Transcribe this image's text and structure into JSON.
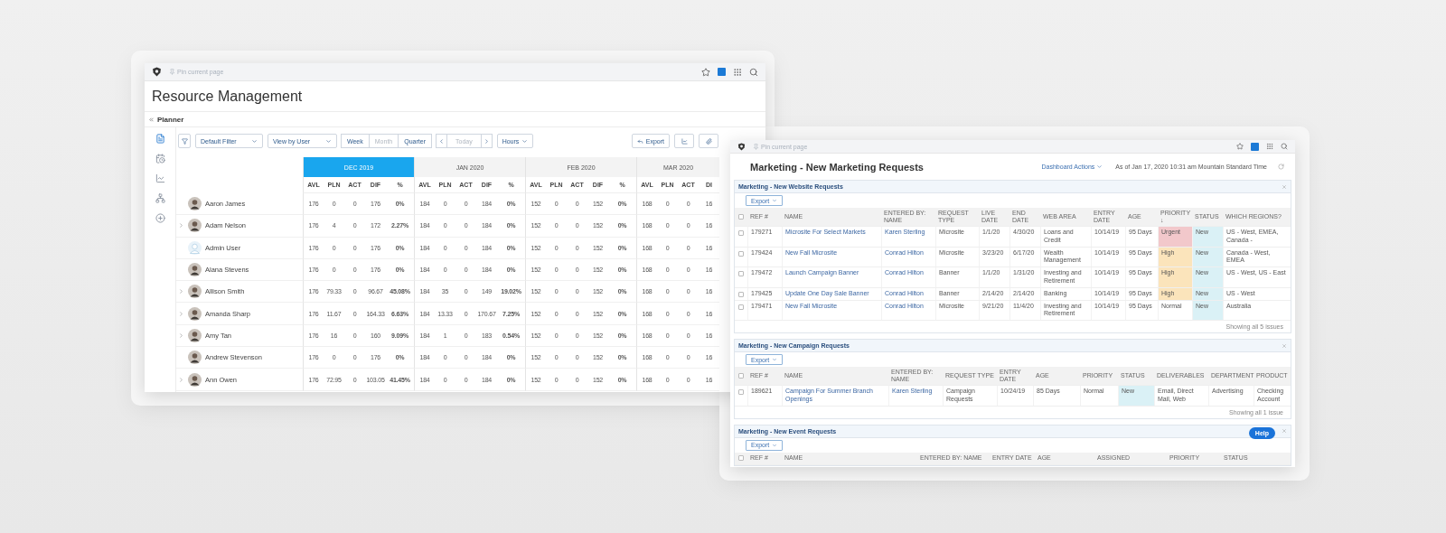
{
  "resource_window": {
    "pin_label": "Pin current page",
    "title": "Resource Management",
    "breadcrumb": "Planner",
    "toolbar": {
      "dropdowns": [
        "Default Filter",
        "View by User"
      ],
      "periods": [
        {
          "label": "Week",
          "disabled": false
        },
        {
          "label": "Month",
          "disabled": true
        },
        {
          "label": "Quarter",
          "disabled": false
        }
      ],
      "today": {
        "label": "Today",
        "disabled": true
      },
      "unit": "Hours",
      "export": "Export"
    },
    "months": [
      {
        "label": "DEC 2019",
        "selected": true,
        "columns": [
          "AVL",
          "PLN",
          "ACT",
          "DIF",
          "%"
        ]
      },
      {
        "label": "JAN 2020",
        "selected": false,
        "columns": [
          "AVL",
          "PLN",
          "ACT",
          "DIF",
          "%"
        ]
      },
      {
        "label": "FEB 2020",
        "selected": false,
        "columns": [
          "AVL",
          "PLN",
          "ACT",
          "DIF",
          "%"
        ]
      },
      {
        "label": "MAR 2020",
        "selected": false,
        "columns": [
          "AVL",
          "PLN",
          "ACT",
          "DI"
        ]
      }
    ],
    "rows": [
      {
        "name": "Aaron James",
        "kind": "photo",
        "expandable": false,
        "values": [
          [
            "176",
            "0",
            "0",
            "176",
            "0%"
          ],
          [
            "184",
            "0",
            "0",
            "184",
            "0%"
          ],
          [
            "152",
            "0",
            "0",
            "152",
            "0%"
          ],
          [
            "168",
            "0",
            "0",
            "16"
          ]
        ]
      },
      {
        "name": "Adam Nelson",
        "kind": "photo",
        "expandable": true,
        "values": [
          [
            "176",
            "4",
            "0",
            "172",
            "2.27%"
          ],
          [
            "184",
            "0",
            "0",
            "184",
            "0%"
          ],
          [
            "152",
            "0",
            "0",
            "152",
            "0%"
          ],
          [
            "168",
            "0",
            "0",
            "16"
          ]
        ]
      },
      {
        "name": "Admin User",
        "kind": "placeholder",
        "expandable": false,
        "values": [
          [
            "176",
            "0",
            "0",
            "176",
            "0%"
          ],
          [
            "184",
            "0",
            "0",
            "184",
            "0%"
          ],
          [
            "152",
            "0",
            "0",
            "152",
            "0%"
          ],
          [
            "168",
            "0",
            "0",
            "16"
          ]
        ]
      },
      {
        "name": "Alana Stevens",
        "kind": "photo",
        "expandable": false,
        "values": [
          [
            "176",
            "0",
            "0",
            "176",
            "0%"
          ],
          [
            "184",
            "0",
            "0",
            "184",
            "0%"
          ],
          [
            "152",
            "0",
            "0",
            "152",
            "0%"
          ],
          [
            "168",
            "0",
            "0",
            "16"
          ]
        ]
      },
      {
        "name": "Allison Smith",
        "kind": "photo",
        "expandable": true,
        "values": [
          [
            "176",
            "79.33",
            "0",
            "96.67",
            "45.08%"
          ],
          [
            "184",
            "35",
            "0",
            "149",
            "19.02%"
          ],
          [
            "152",
            "0",
            "0",
            "152",
            "0%"
          ],
          [
            "168",
            "0",
            "0",
            "16"
          ]
        ]
      },
      {
        "name": "Amanda Sharp",
        "kind": "photo",
        "expandable": true,
        "values": [
          [
            "176",
            "11.67",
            "0",
            "164.33",
            "6.63%"
          ],
          [
            "184",
            "13.33",
            "0",
            "170.67",
            "7.25%"
          ],
          [
            "152",
            "0",
            "0",
            "152",
            "0%"
          ],
          [
            "168",
            "0",
            "0",
            "16"
          ]
        ]
      },
      {
        "name": "Amy Tan",
        "kind": "photo",
        "expandable": true,
        "values": [
          [
            "176",
            "16",
            "0",
            "160",
            "9.09%"
          ],
          [
            "184",
            "1",
            "0",
            "183",
            "0.54%"
          ],
          [
            "152",
            "0",
            "0",
            "152",
            "0%"
          ],
          [
            "168",
            "0",
            "0",
            "16"
          ]
        ]
      },
      {
        "name": "Andrew Stevenson",
        "kind": "photo",
        "expandable": false,
        "values": [
          [
            "176",
            "0",
            "0",
            "176",
            "0%"
          ],
          [
            "184",
            "0",
            "0",
            "184",
            "0%"
          ],
          [
            "152",
            "0",
            "0",
            "152",
            "0%"
          ],
          [
            "168",
            "0",
            "0",
            "16"
          ]
        ]
      },
      {
        "name": "Ann Owen",
        "kind": "photo",
        "expandable": true,
        "values": [
          [
            "176",
            "72.95",
            "0",
            "103.05",
            "41.45%"
          ],
          [
            "184",
            "0",
            "0",
            "184",
            "0%"
          ],
          [
            "152",
            "0",
            "0",
            "152",
            "0%"
          ],
          [
            "168",
            "0",
            "0",
            "16"
          ]
        ]
      }
    ]
  },
  "marketing_window": {
    "pin_label": "Pin current page",
    "title": "Marketing - New Marketing Requests",
    "actions": "Dashboard Actions",
    "timestamp": "As of Jan 17, 2020 10:31 am Mountain Standard Time",
    "help": "Help",
    "sections": [
      {
        "title": "Marketing - New Website Requests",
        "export": "Export",
        "all_checked": false,
        "columns": [
          {
            "label": "REF #",
            "kind": "text"
          },
          {
            "label": "NAME",
            "kind": "link"
          },
          {
            "label": "ENTERED BY: NAME",
            "kind": "link"
          },
          {
            "label": "REQUEST TYPE",
            "kind": "text"
          },
          {
            "label": "LIVE DATE",
            "kind": "text"
          },
          {
            "label": "END DATE",
            "kind": "text"
          },
          {
            "label": "WEB AREA",
            "kind": "text"
          },
          {
            "label": "ENTRY DATE",
            "kind": "text"
          },
          {
            "label": "AGE",
            "kind": "text"
          },
          {
            "label": "PRIORITY ↓",
            "kind": "priority"
          },
          {
            "label": "STATUS",
            "kind": "status"
          },
          {
            "label": "WHICH REGIONS?",
            "kind": "text"
          }
        ],
        "rows": [
          {
            "checked": false,
            "color": "#f2c8cb",
            "cells": [
              "179271",
              "Microsite For Select Markets",
              "Karen Sterling",
              "Microsite",
              "1/1/20",
              "4/30/20",
              "Loans and Credit",
              "10/14/19",
              "95 Days",
              "Urgent",
              "New",
              "US - West, EMEA, Canada -"
            ]
          },
          {
            "checked": false,
            "color": "#fbe4bb",
            "cells": [
              "179424",
              "New Fall Microsite",
              "Conrad Hilton",
              "Microsite",
              "3/23/20",
              "6/17/20",
              "Wealth Management",
              "10/14/19",
              "95 Days",
              "High",
              "New",
              "Canada - West, EMEA"
            ]
          },
          {
            "checked": false,
            "color": "#fbe4bb",
            "cells": [
              "179472",
              "Launch Campaign Banner",
              "Conrad Hilton",
              "Banner",
              "1/1/20",
              "1/31/20",
              "Investing and Retirement",
              "10/14/19",
              "95 Days",
              "High",
              "New",
              "US - West, US - East"
            ]
          },
          {
            "checked": false,
            "color": "#fbe4bb",
            "cells": [
              "179425",
              "Update One Day Sale Banner",
              "Conrad Hilton",
              "Banner",
              "2/14/20",
              "2/14/20",
              "Banking",
              "10/14/19",
              "95 Days",
              "High",
              "New",
              "US - West"
            ]
          },
          {
            "checked": false,
            "cells": [
              "179471",
              "New Fall Microsite",
              "Conrad Hilton",
              "Microsite",
              "9/21/20",
              "11/4/20",
              "Investing and Retirement",
              "10/14/19",
              "95 Days",
              "Normal",
              "New",
              "Australia"
            ]
          }
        ],
        "footer": "Showing all 5 issues"
      },
      {
        "title": "Marketing - New Campaign Requests",
        "export": "Export",
        "all_checked": false,
        "columns": [
          {
            "label": "REF #",
            "kind": "text"
          },
          {
            "label": "NAME",
            "kind": "link"
          },
          {
            "label": "ENTERED BY: NAME",
            "kind": "link"
          },
          {
            "label": "REQUEST TYPE",
            "kind": "text"
          },
          {
            "label": "ENTRY DATE",
            "kind": "text"
          },
          {
            "label": "AGE",
            "kind": "text"
          },
          {
            "label": "PRIORITY",
            "kind": "priority"
          },
          {
            "label": "STATUS",
            "kind": "status"
          },
          {
            "label": "DELIVERABLES",
            "kind": "text"
          },
          {
            "label": "DEPARTMENT",
            "kind": "text"
          },
          {
            "label": "PRODUCT",
            "kind": "text"
          }
        ],
        "rows": [
          {
            "checked": false,
            "cells": [
              "189621",
              "Campaign For Summer Branch Openings",
              "Karen Sterling",
              "Campaign Requests",
              "10/24/19",
              "85 Days",
              "Normal",
              "New",
              "Email, Direct Mail, Web",
              "Advertising",
              "Checking Account"
            ]
          }
        ],
        "footer": "Showing all 1 issue"
      },
      {
        "title": "Marketing - New Event Requests",
        "export": "Export",
        "all_checked": false,
        "columns": [
          {
            "label": "REF #"
          },
          {
            "label": "NAME"
          },
          {
            "label": "ENTERED BY: NAME"
          },
          {
            "label": "ENTRY DATE"
          },
          {
            "label": "AGE"
          },
          {
            "label": "ASSIGNED"
          },
          {
            "label": "PRIORITY"
          },
          {
            "label": "STATUS"
          }
        ]
      }
    ]
  }
}
